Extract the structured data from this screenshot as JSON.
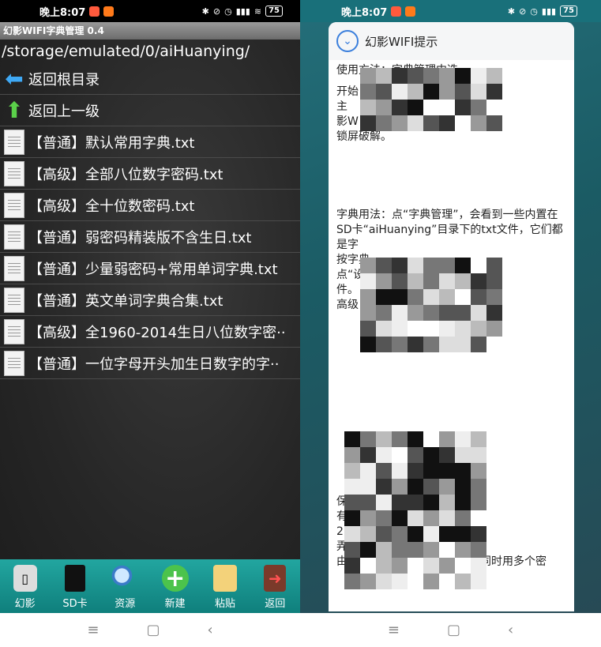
{
  "left": {
    "status": {
      "time": "晚上8:07",
      "battery": "75"
    },
    "app_title": "幻影WIFI字典管理 0.4",
    "path": "/storage/emulated/0/aiHuanying/",
    "nav_rows": [
      {
        "label": "返回根目录",
        "icon": "arrow-left-icon"
      },
      {
        "label": "返回上一级",
        "icon": "arrow-up-icon"
      }
    ],
    "files": [
      "【普通】默认常用字典.txt",
      "【高级】全部八位数字密码.txt",
      "【高级】全十位数密码.txt",
      "【普通】弱密码精装版不含生日.txt",
      "【普通】少量弱密码+常用单词字典.txt",
      "【普通】英文单词字典合集.txt",
      "【高级】全1960-2014生日八位数字密··",
      "【普通】一位字母开头加生日数字的字··"
    ],
    "toolbar": [
      {
        "label": "幻影",
        "icon": "phone-icon"
      },
      {
        "label": "SD卡",
        "icon": "sd-card-icon"
      },
      {
        "label": "资源",
        "icon": "search-icon"
      },
      {
        "label": "新建",
        "icon": "add-icon"
      },
      {
        "label": "粘贴",
        "icon": "paste-icon"
      },
      {
        "label": "返回",
        "icon": "exit-icon"
      }
    ],
    "navbar": {
      "menu": "≡",
      "home": "▢",
      "back": "‹"
    }
  },
  "right": {
    "status": {
      "time": "晚上8:07",
      "battery": "75"
    },
    "dialog_title": "幻影WIFI提示",
    "dialog_text": [
      "使用方法：字典管理中选",
      "开始",
      "主",
      "影W",
      "锁屏破解。",
      "字典用法：点“字典管理”，会看到一些内置在SD卡“aiHuanying”目录下的txt文件，它们都是字",
      "按字典",
      "点“设",
      "件。",
      "高级",
      "保",
      "有",
      "2.",
      "弄",
      "由于手机硬件限制，系统无法同时用多个密"
    ],
    "navbar": {
      "menu": "≡",
      "home": "▢",
      "back": "‹"
    }
  }
}
